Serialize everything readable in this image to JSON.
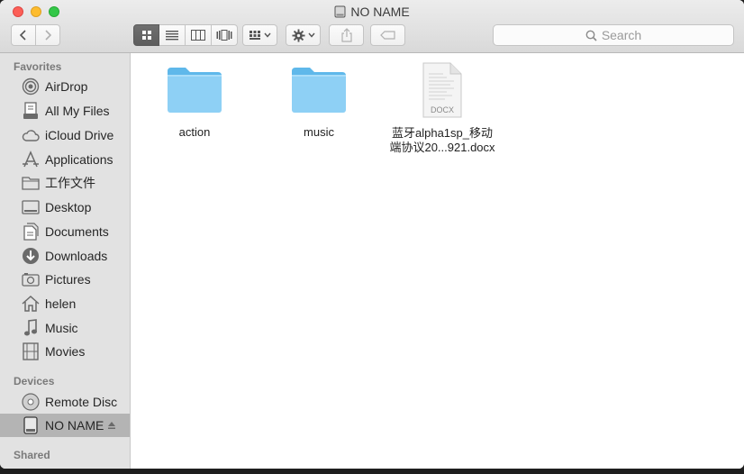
{
  "window": {
    "title": "NO NAME"
  },
  "toolbar": {
    "back_icon": "chevron-left-icon",
    "forward_icon": "chevron-right-icon",
    "view_modes": [
      "icon-view",
      "list-view",
      "column-view",
      "cover-flow-view"
    ],
    "active_view": "icon-view",
    "search_placeholder": "Search"
  },
  "sidebar": {
    "favorites_header": "Favorites",
    "favorites": [
      {
        "label": "AirDrop",
        "icon": "airdrop-icon"
      },
      {
        "label": "All My Files",
        "icon": "all-files-icon"
      },
      {
        "label": "iCloud Drive",
        "icon": "cloud-icon"
      },
      {
        "label": "Applications",
        "icon": "applications-icon"
      },
      {
        "label": "工作文件",
        "icon": "folder-icon"
      },
      {
        "label": "Desktop",
        "icon": "desktop-icon"
      },
      {
        "label": "Documents",
        "icon": "documents-icon"
      },
      {
        "label": "Downloads",
        "icon": "downloads-icon"
      },
      {
        "label": "Pictures",
        "icon": "camera-icon"
      },
      {
        "label": "helen",
        "icon": "home-icon"
      },
      {
        "label": "Music",
        "icon": "music-note-icon"
      },
      {
        "label": "Movies",
        "icon": "film-icon"
      }
    ],
    "devices_header": "Devices",
    "devices": [
      {
        "label": "Remote Disc",
        "icon": "disc-icon"
      },
      {
        "label": "NO NAME",
        "icon": "disk-icon",
        "selected": true
      }
    ],
    "shared_header": "Shared"
  },
  "files": [
    {
      "name": "action",
      "type": "folder"
    },
    {
      "name": "music",
      "type": "folder"
    },
    {
      "name_line1": "蓝牙alpha1sp_移动",
      "name_line2": "端协议20...921.docx",
      "type": "docx",
      "badge": "DOCX"
    }
  ]
}
